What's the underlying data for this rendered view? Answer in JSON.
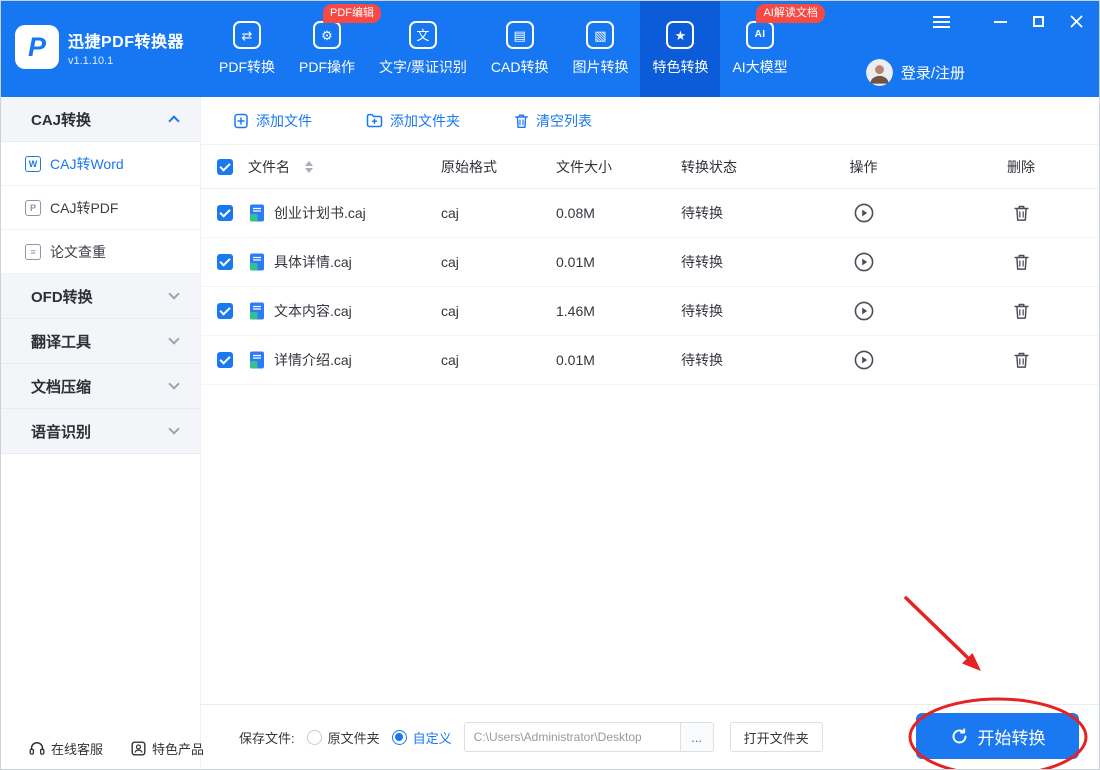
{
  "colors": {
    "accent": "#1a78f0",
    "header_bg": "#1777f3",
    "active_tab_bg": "#0c5bd8",
    "badge_red": "#f64a45",
    "annotation_red": "#e62222"
  },
  "app": {
    "name": "迅捷PDF转换器",
    "version": "v1.1.10.1",
    "logo_glyph": "P"
  },
  "header": {
    "nav": [
      {
        "label": "PDF转换",
        "glyph": "⇄"
      },
      {
        "label": "PDF操作",
        "glyph": "⚙",
        "badge": "PDF编辑"
      },
      {
        "label": "文字/票证识别",
        "glyph": "文"
      },
      {
        "label": "CAD转换",
        "glyph": "▤"
      },
      {
        "label": "图片转换",
        "glyph": "▧"
      },
      {
        "label": "特色转换",
        "glyph": "★",
        "active": true
      },
      {
        "label": "AI大模型",
        "glyph": "AI",
        "badge": "AI解读文档"
      }
    ],
    "login_label": "登录/注册"
  },
  "sidebar": {
    "groups": [
      {
        "label": "CAJ转换",
        "expanded": true,
        "items": [
          {
            "label": "CAJ转Word",
            "glyph": "W",
            "active": true
          },
          {
            "label": "CAJ转PDF",
            "glyph": "P"
          },
          {
            "label": "论文查重",
            "glyph": "≡"
          }
        ]
      },
      {
        "label": "OFD转换",
        "expanded": false
      },
      {
        "label": "翻译工具",
        "expanded": false
      },
      {
        "label": "文档压缩",
        "expanded": false
      },
      {
        "label": "语音识别",
        "expanded": false
      }
    ]
  },
  "toolbar": {
    "add_file": "添加文件",
    "add_folder": "添加文件夹",
    "clear_list": "清空列表"
  },
  "table": {
    "headers": {
      "name": "文件名",
      "format": "原始格式",
      "size": "文件大小",
      "status": "转换状态",
      "action": "操作",
      "delete": "删除"
    },
    "rows": [
      {
        "name": "创业计划书.caj",
        "format": "caj",
        "size": "0.08M",
        "status": "待转换",
        "checked": true
      },
      {
        "name": "具体详情.caj",
        "format": "caj",
        "size": "0.01M",
        "status": "待转换",
        "checked": true
      },
      {
        "name": "文本内容.caj",
        "format": "caj",
        "size": "1.46M",
        "status": "待转换",
        "checked": true
      },
      {
        "name": "详情介绍.caj",
        "format": "caj",
        "size": "0.01M",
        "status": "待转换",
        "checked": true
      }
    ]
  },
  "bottom": {
    "save_label": "保存文件:",
    "radio_original": "原文件夹",
    "radio_custom": "自定义",
    "path": "C:\\Users\\Administrator\\Desktop",
    "browse": "...",
    "open_folder": "打开文件夹",
    "start": "开始转换"
  },
  "footer": {
    "online_service": "在线客服",
    "featured_products": "特色产品"
  }
}
